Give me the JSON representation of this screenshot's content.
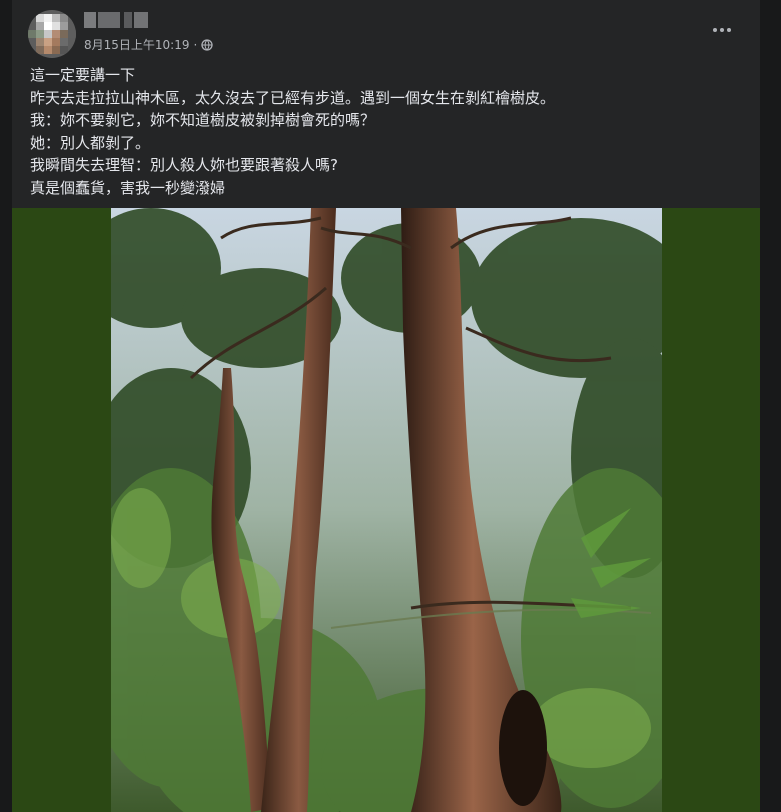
{
  "post": {
    "author_name": "",
    "timestamp": "8月15日上午10:19",
    "separator": "·",
    "audience_icon": "globe-icon",
    "more_icon": "more-options-icon",
    "lines": [
      "這一定要講一下",
      "昨天去走拉拉山神木區，太久沒去了已經有步道。遇到一個女生在剝紅檜樹皮。",
      "我：妳不要剝它，妳不知道樹皮被剝掉樹會死的嗎？",
      "她：別人都剝了。",
      "我瞬間失去理智：別人殺人妳也要跟著殺人嗎?",
      "真是個蠢貨，害我一秒變潑婦"
    ]
  },
  "colors": {
    "page_bg": "#18191a",
    "card_bg": "#242526",
    "text_primary": "#e4e6eb",
    "text_secondary": "#b0b3b8",
    "photo_letterbox": "#2b4814"
  }
}
